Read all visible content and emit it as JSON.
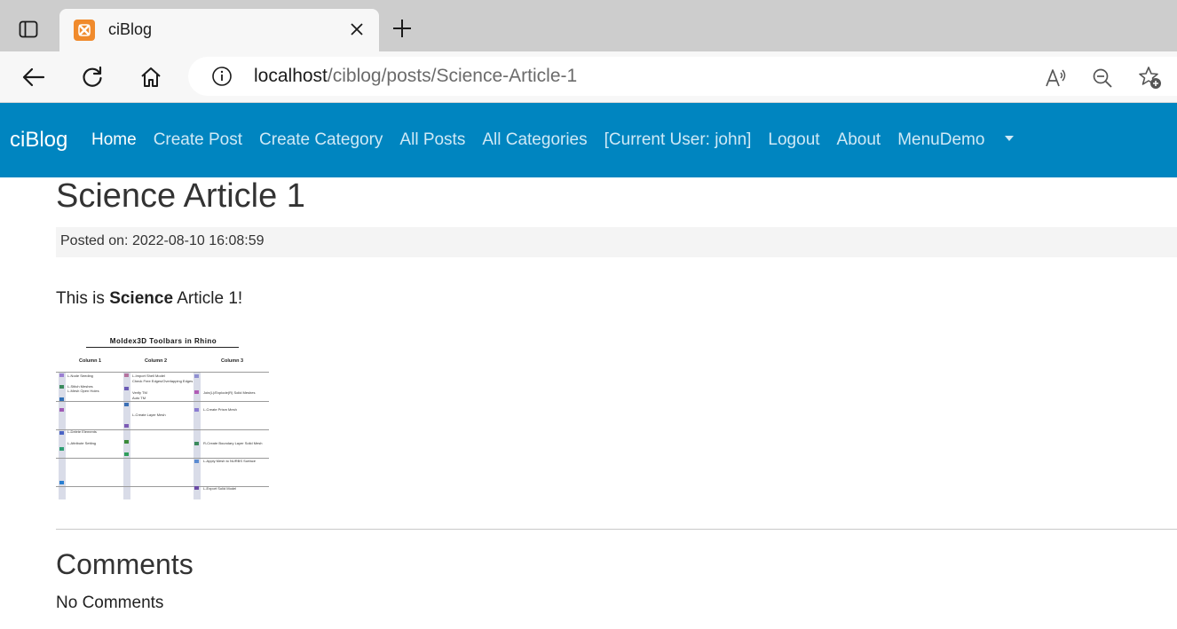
{
  "browser": {
    "tab_title": "ciBlog",
    "url_host": "localhost",
    "url_path": "/ciblog/posts/Science-Article-1"
  },
  "navbar": {
    "brand": "ciBlog",
    "links": [
      {
        "label": "Home"
      },
      {
        "label": "Create Post"
      },
      {
        "label": "Create Category"
      },
      {
        "label": "All Posts"
      },
      {
        "label": "All Categories"
      },
      {
        "label": "[Current User: john]"
      },
      {
        "label": "Logout"
      },
      {
        "label": "About"
      },
      {
        "label": "MenuDemo"
      }
    ],
    "bg_color": "#0085c0"
  },
  "post": {
    "title": "Science Article 1",
    "posted_on": "Posted on: 2022-08-10 16:08:59",
    "body_prefix": "This is ",
    "body_bold": "Science",
    "body_suffix": " Article 1!",
    "image": {
      "heading": "Moldex3D Toolbars in Rhino",
      "columns": [
        "Column 1",
        "Column 2",
        "Column 3"
      ],
      "col1_items": [
        "L-Node Seeding",
        "L-Stitch Meshes",
        "L-Mesh Open Holes",
        "L-Delete Elements",
        "L-Attribute Setting"
      ],
      "col2_items": [
        "L-Import Shell Model",
        "Check Free Edges/Overlapping Edges",
        "Verify TM",
        "Auto TM",
        "L-Create Layer Mesh"
      ],
      "col3_items": [
        "Join(L)/Explode(R) Solid Meshes",
        "L-Create Prism Mesh",
        "R-Create Boundary Layer Solid Mesh",
        "L-Apply Mesh to NURBS Surface",
        "L-Export Solid Model"
      ]
    }
  },
  "comments": {
    "heading": "Comments",
    "empty_text": "No Comments"
  }
}
